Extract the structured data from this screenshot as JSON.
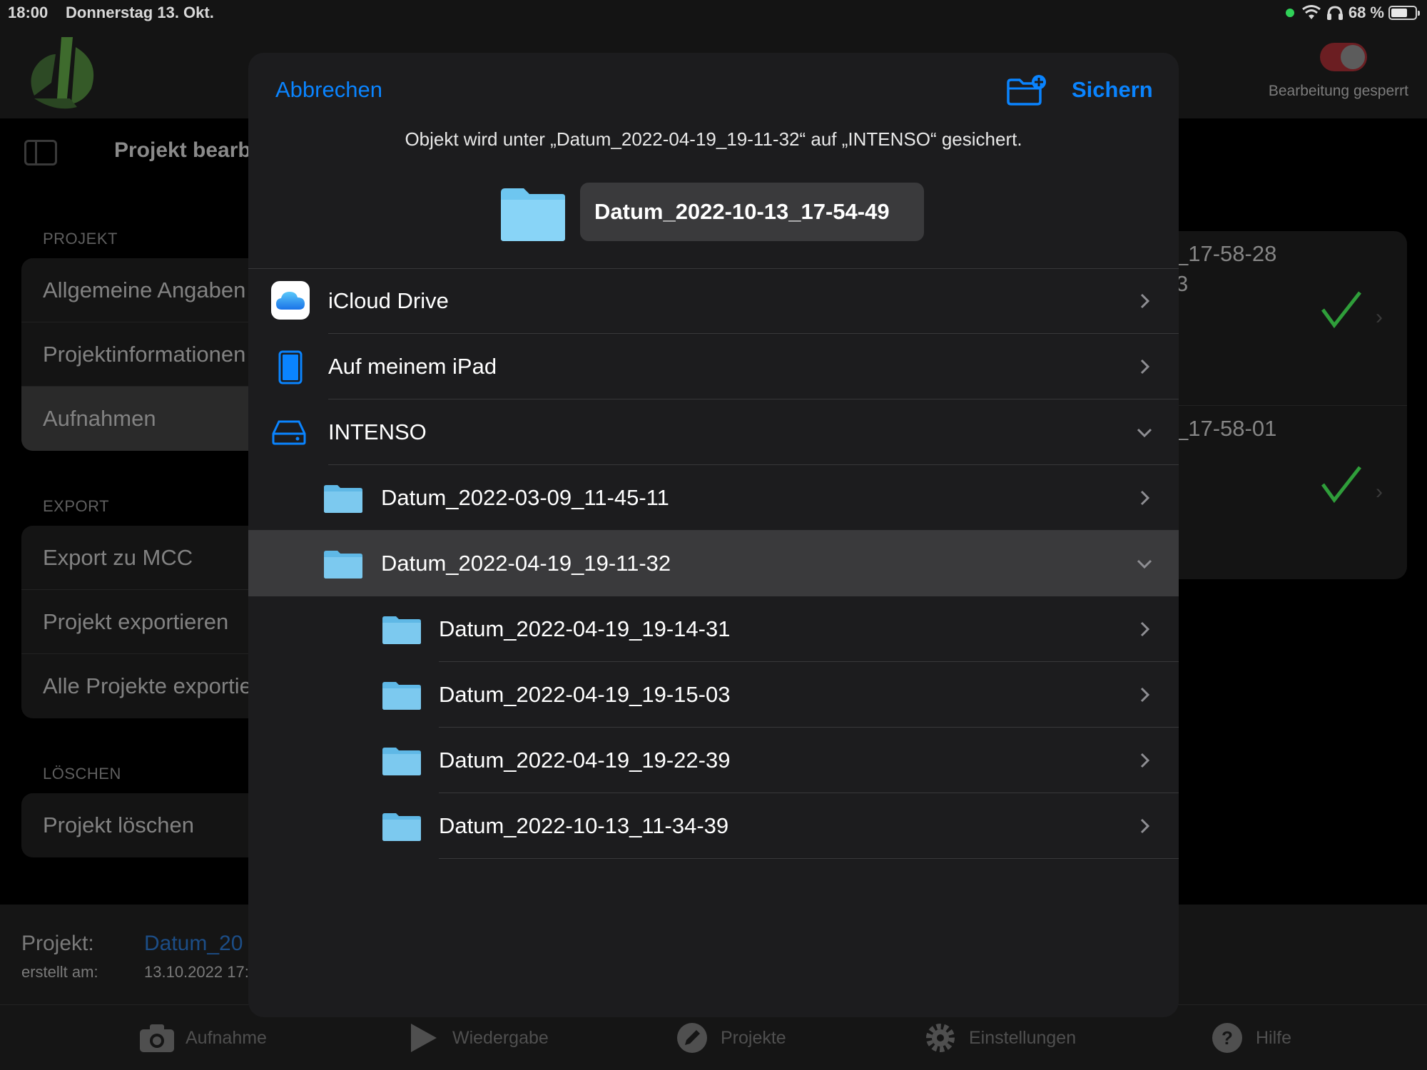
{
  "status_bar": {
    "time": "18:00",
    "date": "Donnerstag 13. Okt.",
    "battery": "68 %",
    "battery_level": 0.68
  },
  "header": {
    "lock_label": "Bearbeitung gesperrt",
    "toggle_on_color": "#6b1e22"
  },
  "sidebar": {
    "title": "Projekt bearb",
    "sections": [
      {
        "label": "PROJEKT",
        "items": [
          "Allgemeine Angaben",
          "Projektinformationen",
          "Aufnahmen"
        ]
      },
      {
        "label": "EXPORT",
        "items": [
          "Export zu MCC",
          "Projekt exportieren",
          "Alle Projekte exportie"
        ]
      },
      {
        "label": "LÖSCHEN",
        "items": [
          "Projekt löschen"
        ]
      }
    ],
    "selected_item": "Aufnahmen"
  },
  "recordings": [
    {
      "line1": "_17-58-28",
      "line2": "3"
    },
    {
      "line1": "_17-58-01",
      "line2": ""
    }
  ],
  "project_info": {
    "project_label": "Projekt:",
    "project_value": "Datum_20",
    "created_label": "erstellt am:",
    "created_value": "13.10.2022 17:"
  },
  "tabbar": {
    "items": [
      "Aufnahme",
      "Wiedergabe",
      "Projekte",
      "Einstellungen",
      "Hilfe"
    ]
  },
  "sheet": {
    "cancel_label": "Abbrechen",
    "save_label": "Sichern",
    "message": "Objekt wird unter „Datum_2022-04-19_19-11-32“ auf „INTENSO“ gesichert.",
    "filename": "Datum_2022-10-13_17-54-49",
    "accent_color": "#0a84ff",
    "locations": [
      {
        "label": "iCloud Drive",
        "icon": "icloud-icon",
        "expanded": false
      },
      {
        "label": "Auf meinem iPad",
        "icon": "ipad-icon",
        "expanded": false
      },
      {
        "label": "INTENSO",
        "icon": "external-drive-icon",
        "expanded": true
      }
    ],
    "folders": [
      {
        "label": "Datum_2022-03-09_11-45-11",
        "level": 1,
        "expanded": false,
        "selected": false
      },
      {
        "label": "Datum_2022-04-19_19-11-32",
        "level": 1,
        "expanded": true,
        "selected": true
      },
      {
        "label": "Datum_2022-04-19_19-14-31",
        "level": 2,
        "expanded": false,
        "selected": false
      },
      {
        "label": "Datum_2022-04-19_19-15-03",
        "level": 2,
        "expanded": false,
        "selected": false
      },
      {
        "label": "Datum_2022-04-19_19-22-39",
        "level": 2,
        "expanded": false,
        "selected": false
      },
      {
        "label": "Datum_2022-10-13_11-34-39",
        "level": 2,
        "expanded": false,
        "selected": false
      }
    ]
  }
}
